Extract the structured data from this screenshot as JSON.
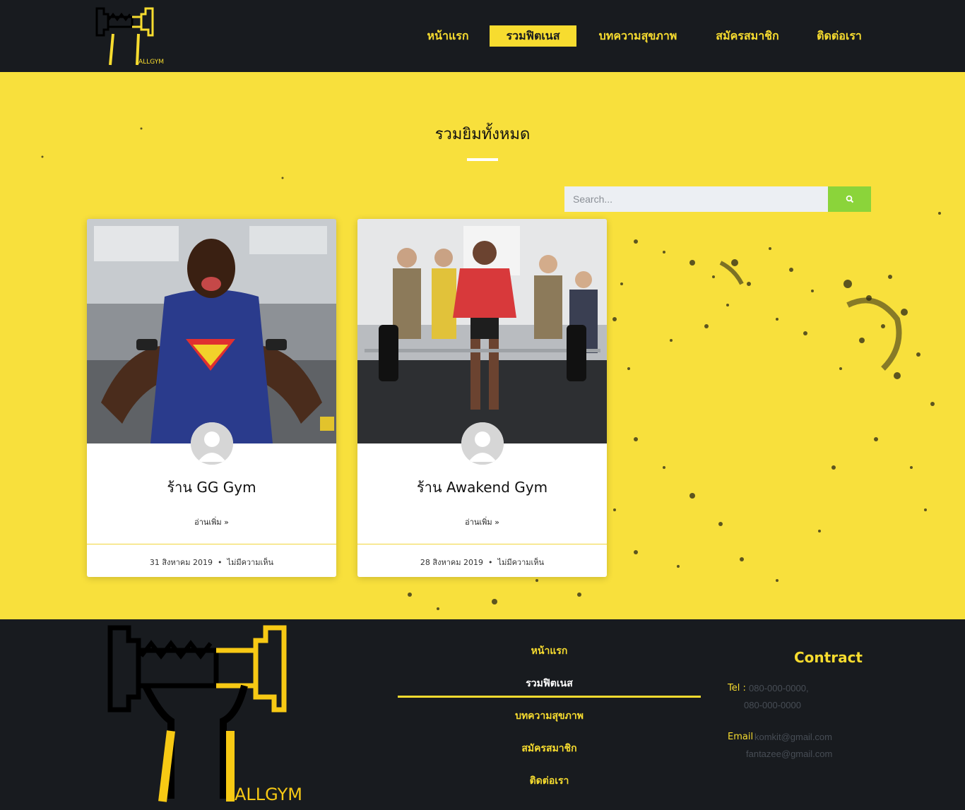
{
  "brand": {
    "logo_text": "ALLGYM",
    "accent": "#f7dc2f",
    "dark": "#181b1f"
  },
  "nav": {
    "items": [
      {
        "label": "หน้าแรก",
        "active": false
      },
      {
        "label": "รวมฟิตเนส",
        "active": true
      },
      {
        "label": "บทความสุขภาพ",
        "active": false
      },
      {
        "label": "สมัครสมาชิก",
        "active": false
      },
      {
        "label": "ติดต่อเรา",
        "active": false
      }
    ]
  },
  "main": {
    "title": "รวมยิมทั้งหมด",
    "search": {
      "placeholder": "Search...",
      "icon": "search-icon",
      "button_color": "#8bd43a"
    },
    "posts": [
      {
        "title": "ร้าน GG Gym",
        "read_more": "อ่านเพิ่ม »",
        "date": "31 สิงหาคม 2019",
        "comments": "ไม่มีความเห็น",
        "image": "bodybuilder-superman-tank"
      },
      {
        "title": "ร้าน Awakend Gym",
        "read_more": "อ่านเพิ่ม »",
        "date": "28 สิงหาคม 2019",
        "comments": "ไม่มีความเห็น",
        "image": "deadlift-red-shirt"
      }
    ]
  },
  "footer": {
    "logo_text": "ALLGYM",
    "nav": [
      {
        "label": "หน้าแรก",
        "active": false
      },
      {
        "label": "รวมฟิตเนส",
        "active": true
      },
      {
        "label": "บทความสุขภาพ",
        "active": false
      },
      {
        "label": "สมัครสมาชิก",
        "active": false
      },
      {
        "label": "ติดต่อเรา",
        "active": false
      }
    ],
    "contact": {
      "title": "Contract",
      "tel_label": "Tel :",
      "tel_1": "080-000-0000,",
      "tel_2": "080-000-0000",
      "email_label": "Email",
      "email_1": "komkit@gmail.com",
      "email_2": "fantazee@gmail.com"
    }
  }
}
